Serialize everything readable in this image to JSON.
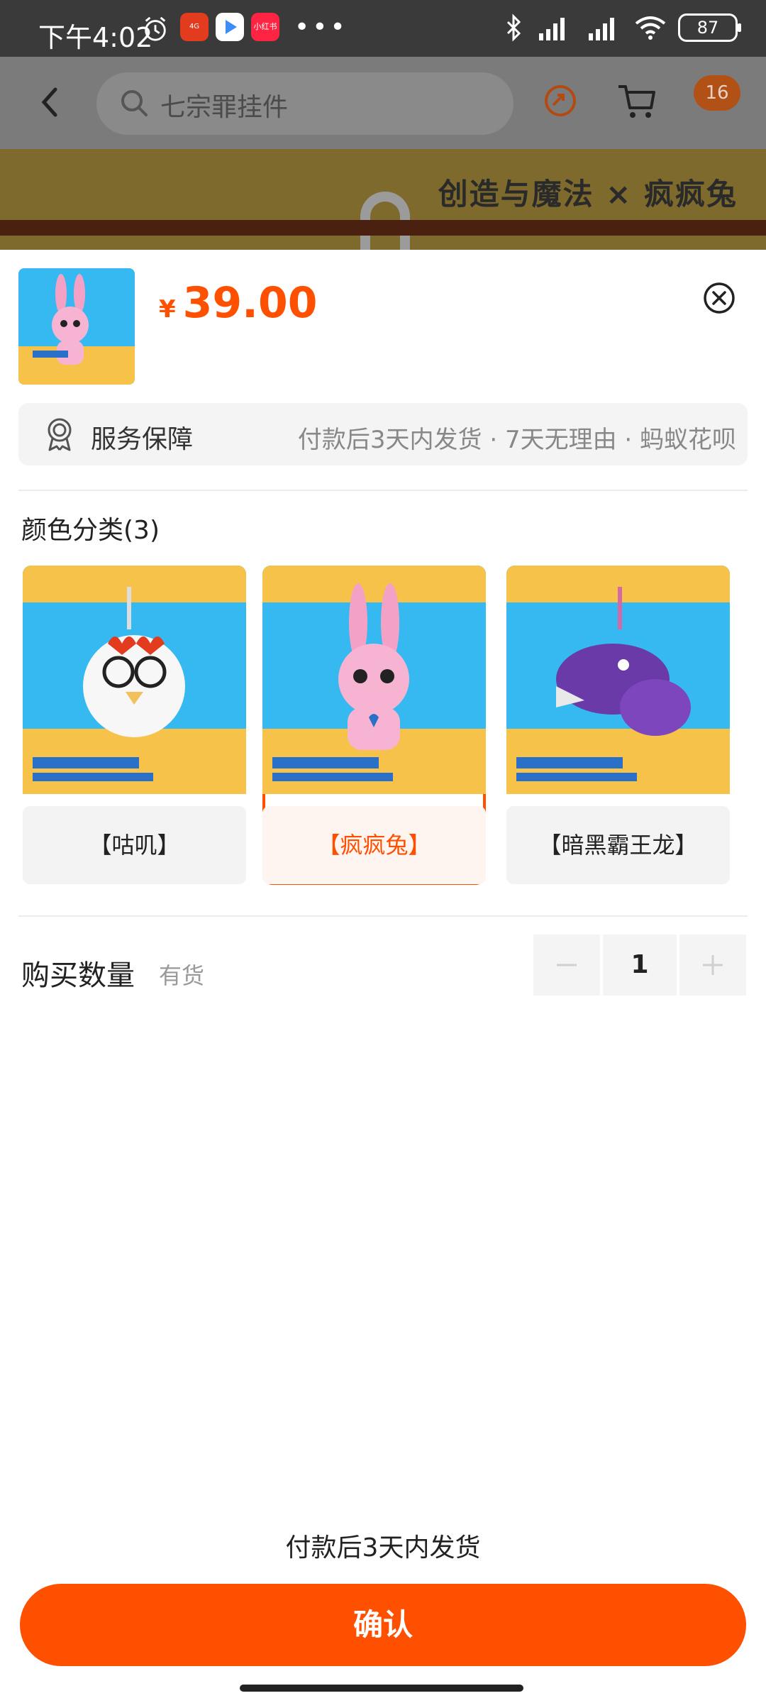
{
  "status_bar": {
    "time": "下午4:02",
    "battery": "87",
    "app_icon_1": "4G",
    "app_icon_3": "小红书"
  },
  "header": {
    "search_text": "七宗罪挂件",
    "cart_badge": "16"
  },
  "banner": {
    "logo_text": "创造与魔法 × 疯疯兔"
  },
  "product": {
    "price_symbol": "¥",
    "price": "39.00"
  },
  "service": {
    "label": "服务保障",
    "detail": "付款后3天内发货 · 7天无理由 · 蚂蚁花呗"
  },
  "options": {
    "title": "颜色分类(3)",
    "items": [
      {
        "label": "【咕叽】",
        "selected": false
      },
      {
        "label": "【疯疯兔】",
        "selected": true
      },
      {
        "label": "【暗黑霸王龙】",
        "selected": false
      }
    ]
  },
  "quantity": {
    "title": "购买数量",
    "stock": "有货",
    "value": "1"
  },
  "footer": {
    "ship_note": "付款后3天内发货",
    "confirm_label": "确认"
  },
  "colors": {
    "accent": "#ff5000",
    "status_bar": "#3a3a3a",
    "overlay": "#7b7b7b"
  }
}
